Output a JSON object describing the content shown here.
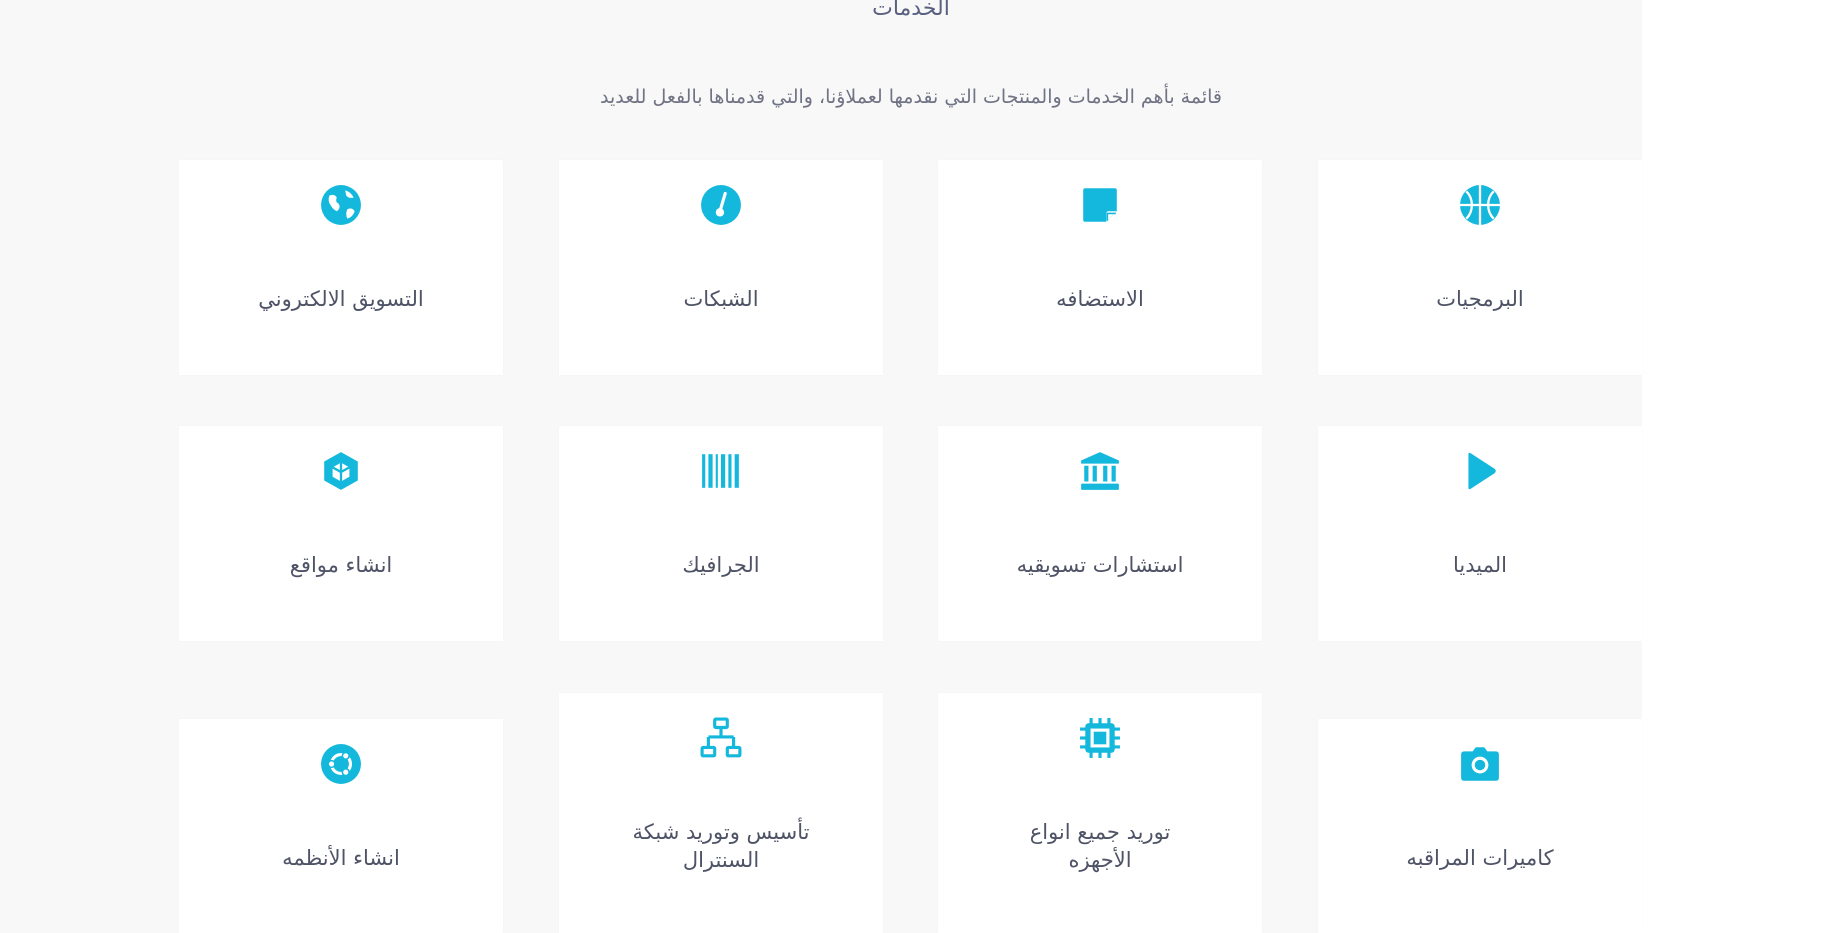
{
  "section": {
    "title": "الخدمات",
    "subtitle": "قائمة بأهم الخدمات والمنتجات التي نقدمها لعملاؤنا، والتي قدمناها بالفعل للعديد"
  },
  "colors": {
    "accent": "#14b8dc",
    "background": "#f8f8f8",
    "card": "#ffffff",
    "text": "#4e5366"
  },
  "services": [
    {
      "label": "البرمجيات",
      "icon": "basketball-icon"
    },
    {
      "label": "الاستضافه",
      "icon": "sticky-note-icon"
    },
    {
      "label": "الشبكات",
      "icon": "gauge-icon"
    },
    {
      "label": "التسويق الالكتروني",
      "icon": "globe-icon"
    },
    {
      "label": "الميديا",
      "icon": "play-icon"
    },
    {
      "label": "استشارات تسويقيه",
      "icon": "bank-icon"
    },
    {
      "label": "الجرافيك",
      "icon": "barcode-icon"
    },
    {
      "label": "انشاء مواقع",
      "icon": "cube-icon"
    },
    {
      "label": "كاميرات المراقبه",
      "icon": "camera-icon"
    },
    {
      "label": "توريد جميع انواع\nالأجهزه",
      "icon": "chip-icon"
    },
    {
      "label": "تأسيس وتوريد شبكة\nالسنترال",
      "icon": "network-icon"
    },
    {
      "label": "انشاء الأنظمه",
      "icon": "ubuntu-icon"
    }
  ]
}
